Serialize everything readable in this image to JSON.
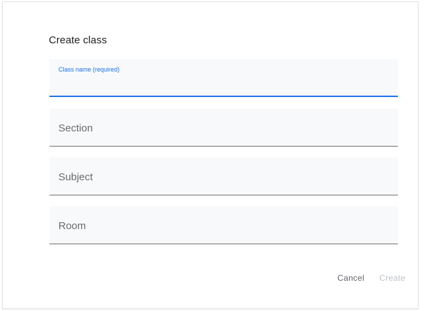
{
  "dialog": {
    "title": "Create class",
    "fields": {
      "class_name": {
        "label": "Class name (required)",
        "value": ""
      },
      "section": {
        "label": "Section",
        "value": ""
      },
      "subject": {
        "label": "Subject",
        "value": ""
      },
      "room": {
        "label": "Room",
        "value": ""
      }
    },
    "actions": {
      "cancel_label": "Cancel",
      "create_label": "Create"
    }
  },
  "colors": {
    "accent": "#1a73e8",
    "field_background": "#f8f9fb",
    "disabled_text": "#bdc1c6"
  }
}
